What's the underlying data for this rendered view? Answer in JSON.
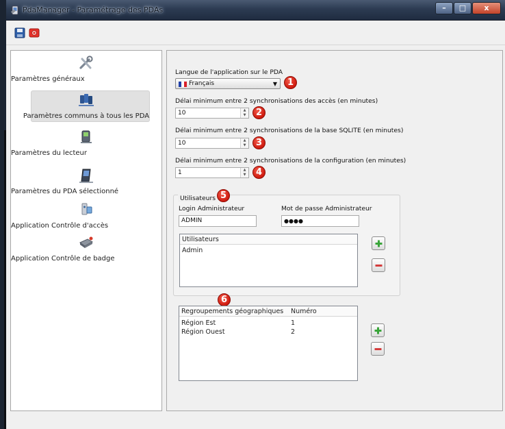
{
  "window": {
    "title": "PdaManager - Paramétrage des PDAs",
    "minimize_glyph": "–",
    "maximize_glyph": "□",
    "close_glyph": "x"
  },
  "toolbar": {
    "save_icon": "save-icon",
    "camera_icon": "camera-icon"
  },
  "nav": {
    "items": [
      {
        "label": "Paramètres généraux",
        "icon": "tools-icon"
      },
      {
        "label": "Paramètres communs à tous les PDA",
        "icon": "multiple-pda-icon",
        "selected": true
      },
      {
        "label": "Paramètres du lecteur",
        "icon": "reader-icon"
      },
      {
        "label": "Paramètres du PDA sélectionné",
        "icon": "pda-icon"
      },
      {
        "label": "Application Contrôle d'accès",
        "icon": "access-control-icon"
      },
      {
        "label": "Application Contrôle de badge",
        "icon": "badge-control-icon"
      }
    ]
  },
  "settings": {
    "language_label": "Langue de l'application sur le PDA",
    "language_value": "Français",
    "access_sync_label": "Délai minimum entre 2 synchronisations des accès (en minutes)",
    "access_sync_value": "10",
    "sqlite_sync_label": "Délai minimum entre 2 synchronisations de la base SQLITE (en minutes)",
    "sqlite_sync_value": "10",
    "config_sync_label": "Délai minimum entre 2 synchronisations de la configuration (en minutes)",
    "config_sync_value": "1"
  },
  "users": {
    "group_title": "Utilisateurs",
    "login_label": "Login Administrateur",
    "login_value": "ADMIN",
    "password_label": "Mot de passe Administrateur",
    "password_value": "●●●●",
    "list_header": "Utilisateurs",
    "list_items": [
      "Admin"
    ]
  },
  "regions": {
    "header_name": "Regroupements géographiques",
    "header_number": "Numéro",
    "rows": [
      {
        "name": "Région Est",
        "number": "1"
      },
      {
        "name": "Région Ouest",
        "number": "2"
      }
    ]
  },
  "callouts": [
    "1",
    "2",
    "3",
    "4",
    "5",
    "6"
  ],
  "colors": {
    "callout": "#d1170b",
    "selected_nav": "#e1e1e1",
    "add_green": "#3aa53a",
    "remove_red": "#d43c3c"
  }
}
